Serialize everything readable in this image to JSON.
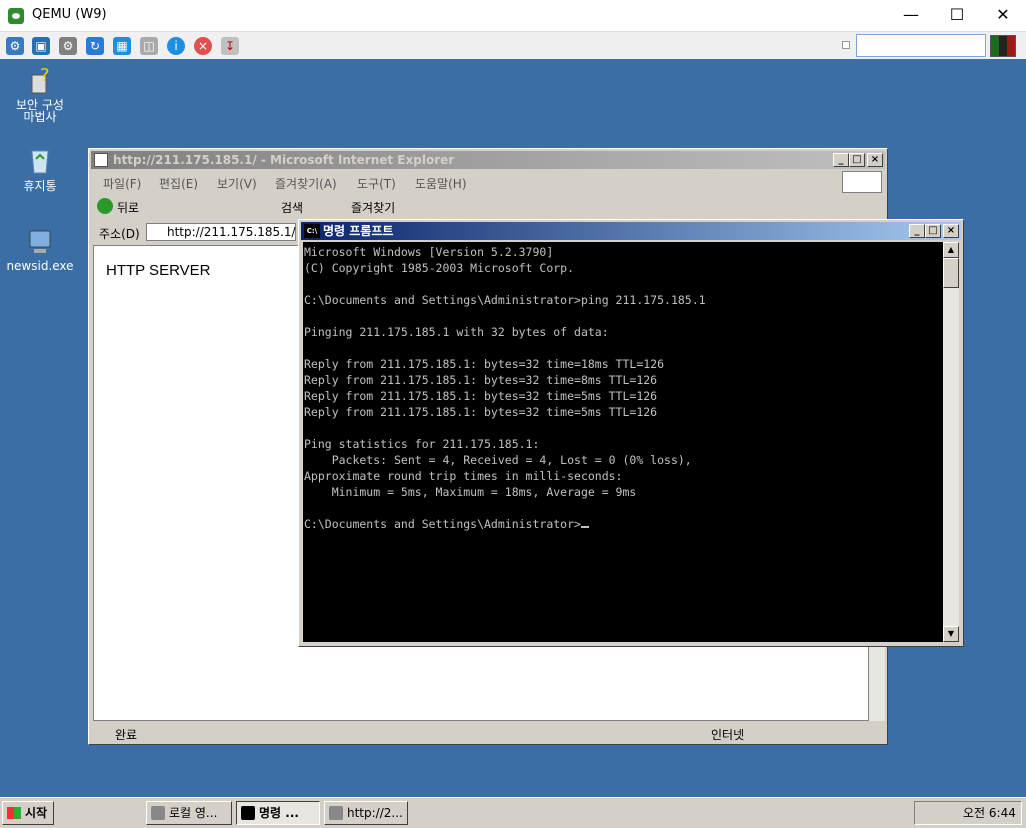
{
  "host": {
    "title": "QEMU (W9)",
    "toolbar_icons": [
      "settings-icon",
      "fullscreen-icon",
      "gear-icon",
      "refresh-icon",
      "windows-icon",
      "usb-icon",
      "info-icon",
      "close-icon",
      "download-icon"
    ],
    "colors": {
      "accent": "#2e8b2e"
    }
  },
  "desktop": {
    "background": "#3a6ea5",
    "icons": [
      {
        "label": "보안 구성\n마법사",
        "icon": "security-wizard-icon"
      },
      {
        "label": "휴지통",
        "icon": "recycle-bin-icon"
      },
      {
        "label": "newsid.exe",
        "icon": "computer-icon"
      }
    ]
  },
  "ie": {
    "title": "http://211.175.185.1/ - Microsoft Internet Explorer",
    "menu": [
      "파일(F)",
      "편집(E)",
      "보기(V)",
      "즐겨찾기(A)",
      "도구(T)",
      "도움말(H)"
    ],
    "toolbar": {
      "back": "뒤로",
      "search": "검색",
      "favorites": "즐겨찾기"
    },
    "address_label": "주소(D)",
    "address_value": "http://211.175.185.1/",
    "page_text": "HTTP SERVER",
    "status_text": "완료",
    "zone_text": "인터넷"
  },
  "cmd": {
    "title": "명령 프롬프트",
    "lines": [
      "Microsoft Windows [Version 5.2.3790]",
      "(C) Copyright 1985-2003 Microsoft Corp.",
      "",
      "C:\\Documents and Settings\\Administrator>ping 211.175.185.1",
      "",
      "Pinging 211.175.185.1 with 32 bytes of data:",
      "",
      "Reply from 211.175.185.1: bytes=32 time=18ms TTL=126",
      "Reply from 211.175.185.1: bytes=32 time=8ms TTL=126",
      "Reply from 211.175.185.1: bytes=32 time=5ms TTL=126",
      "Reply from 211.175.185.1: bytes=32 time=5ms TTL=126",
      "",
      "Ping statistics for 211.175.185.1:",
      "    Packets: Sent = 4, Received = 4, Lost = 0 (0% loss),",
      "Approximate round trip times in milli-seconds:",
      "    Minimum = 5ms, Maximum = 18ms, Average = 9ms",
      "",
      "C:\\Documents and Settings\\Administrator>"
    ]
  },
  "taskbar": {
    "start_label": "시작",
    "tasks": [
      "로컬 영...",
      "명령 ...",
      "http://2..."
    ],
    "clock": "오전 6:44"
  }
}
